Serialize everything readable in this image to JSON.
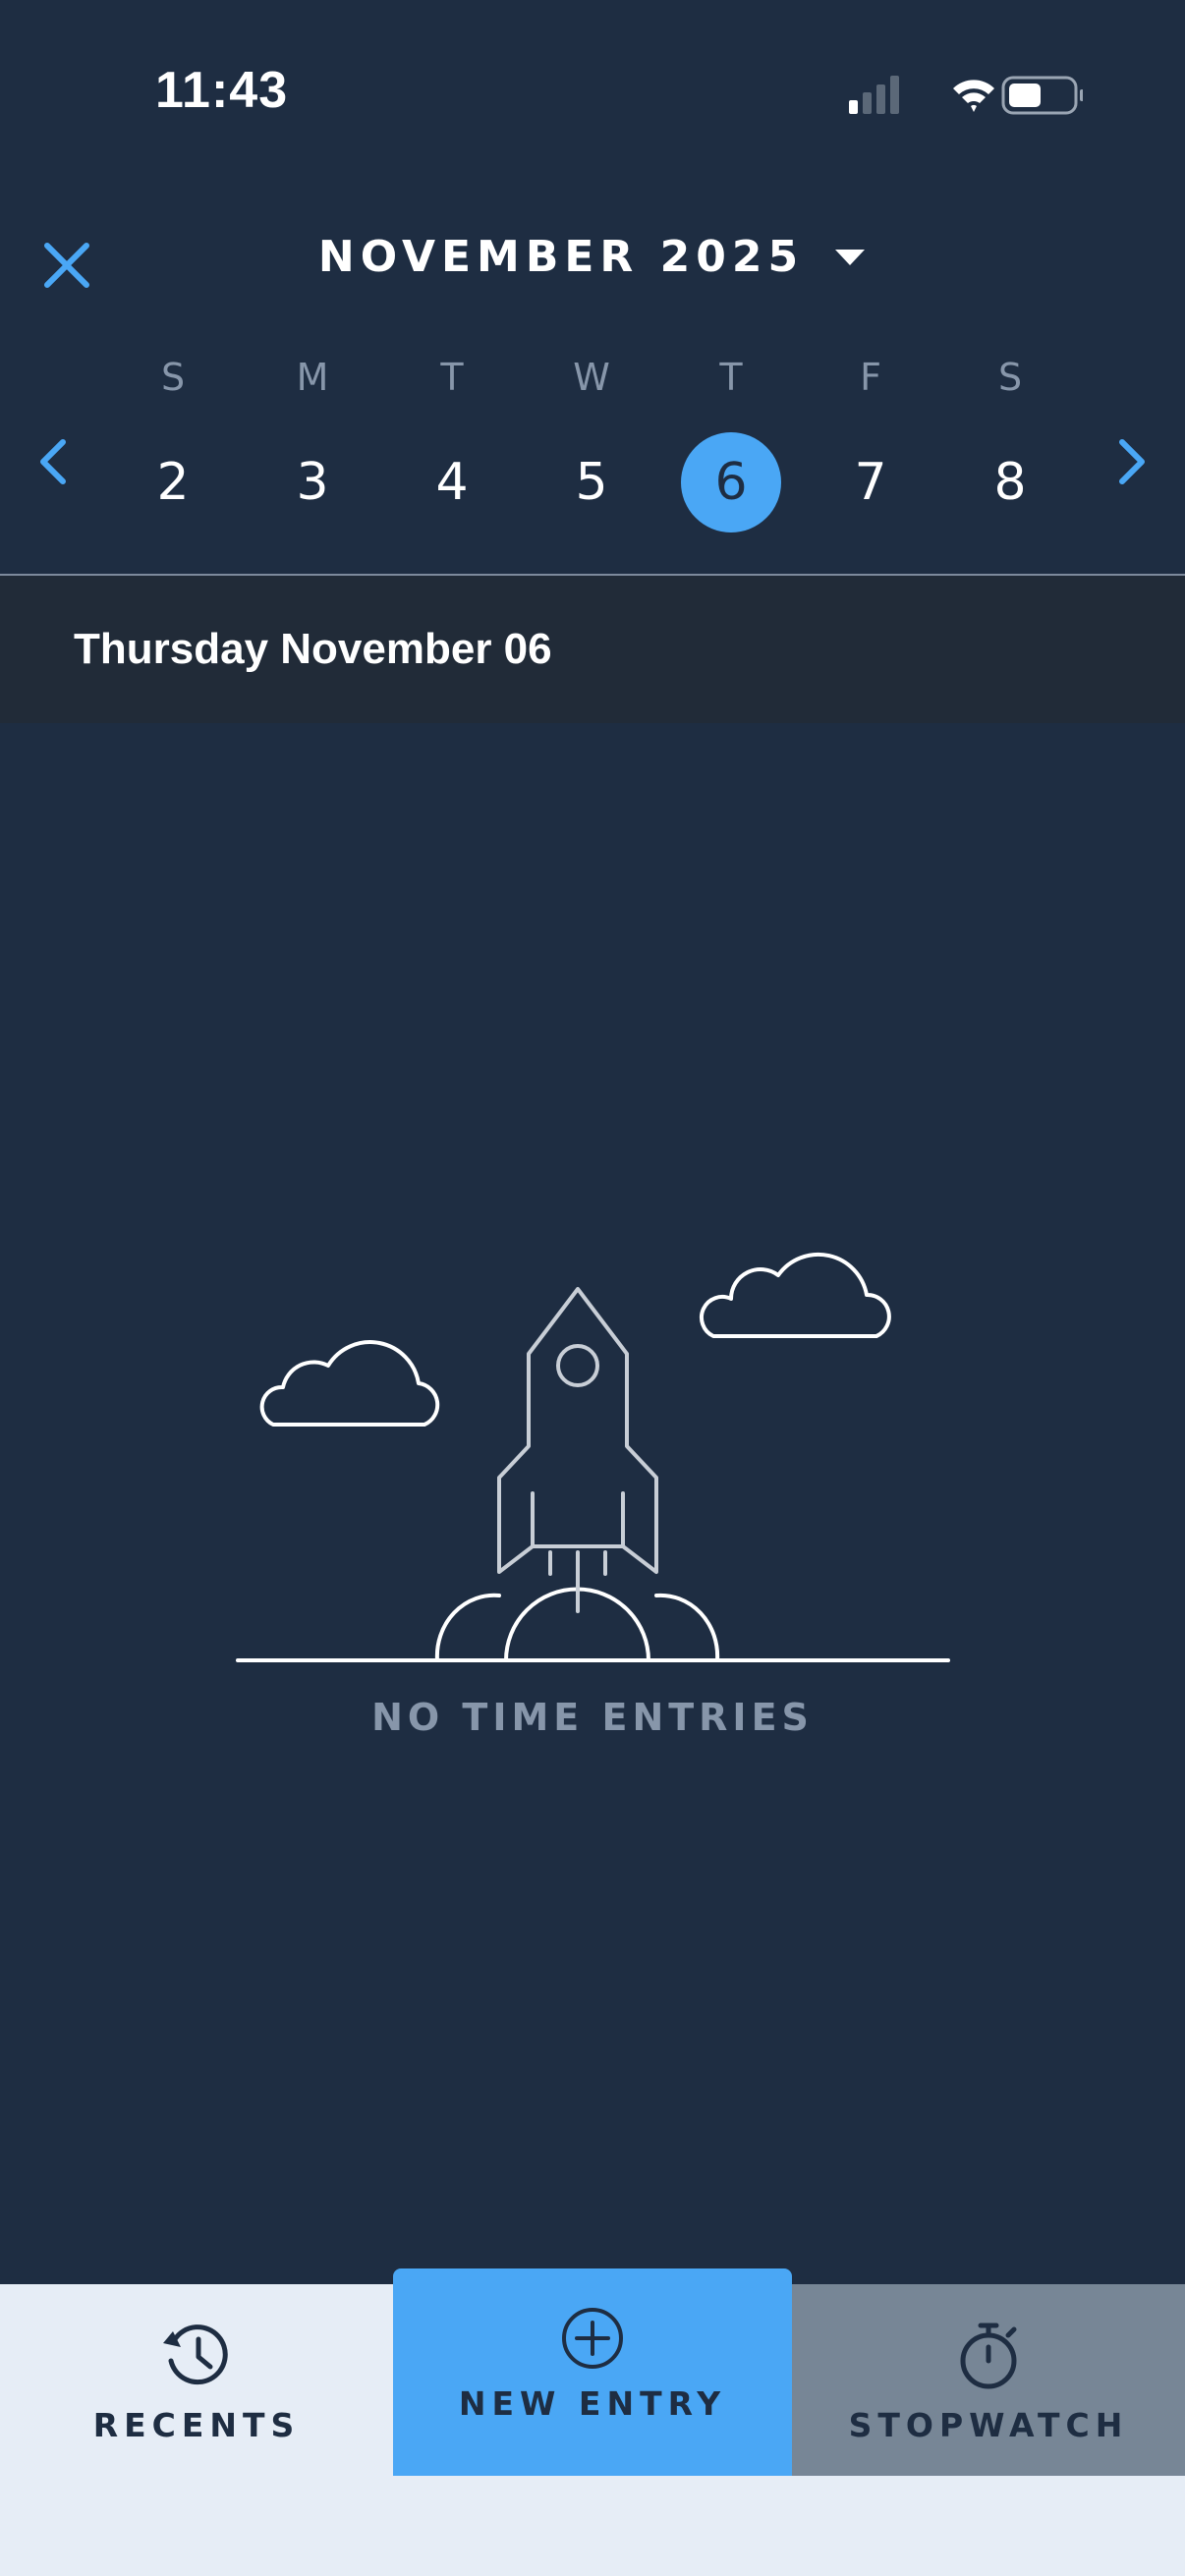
{
  "status_bar": {
    "time": "11:43",
    "icons": [
      "cellular-signal-icon",
      "wifi-icon",
      "battery-icon"
    ]
  },
  "header": {
    "close_icon": "close-icon",
    "month_label": "NOVEMBER 2025",
    "month_dropdown_icon": "caret-down-icon"
  },
  "week": {
    "weekdays": [
      "S",
      "M",
      "T",
      "W",
      "T",
      "F",
      "S"
    ],
    "days": [
      "2",
      "3",
      "4",
      "5",
      "6",
      "7",
      "8"
    ],
    "selected_day": "6",
    "prev_icon": "chevron-left-icon",
    "next_icon": "chevron-right-icon"
  },
  "date_heading": "Thursday November 06",
  "empty_state": {
    "illustration_icon": "rocket-launch-icon",
    "message": "NO TIME ENTRIES"
  },
  "bottom_bar": {
    "recents_label": "RECENTS",
    "new_entry_label": "NEW ENTRY",
    "stopwatch_label": "STOPWATCH"
  },
  "colors": {
    "background": "#1e2d42",
    "accent": "#4aa7f5",
    "date_band": "#212b38",
    "muted_text": "#8796aa",
    "stopwatch_tab": "#778696",
    "bottom_bar": "#e6edf6"
  }
}
